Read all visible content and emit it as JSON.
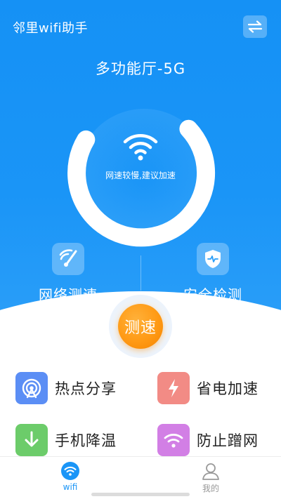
{
  "header": {
    "app_title": "邻里wifi助手",
    "network_name": "多功能厅-5G"
  },
  "gauge": {
    "status_text": "网速较慢,建议加速"
  },
  "features": [
    {
      "label": "网络测速",
      "icon": "speedometer-icon"
    },
    {
      "label": "安全检测",
      "icon": "shield-icon"
    }
  ],
  "speed_button": {
    "label": "测速"
  },
  "tools": [
    {
      "label": "热点分享",
      "icon": "hotspot-icon",
      "color": "#5b8ef5"
    },
    {
      "label": "省电加速",
      "icon": "lightning-icon",
      "color": "#f28b85"
    },
    {
      "label": "手机降温",
      "icon": "download-arrow-icon",
      "color": "#6ccc6a"
    },
    {
      "label": "防止蹭网",
      "icon": "wifi-icon",
      "color": "#d27fe5"
    }
  ],
  "tabbar": {
    "tabs": [
      {
        "label": "wifi",
        "active": true
      },
      {
        "label": "我的",
        "active": false
      }
    ]
  },
  "colors": {
    "primary": "#1a95f7",
    "accent_orange": "#ff9a15",
    "tab_active": "#1a95f7",
    "tab_inactive": "#999999"
  }
}
